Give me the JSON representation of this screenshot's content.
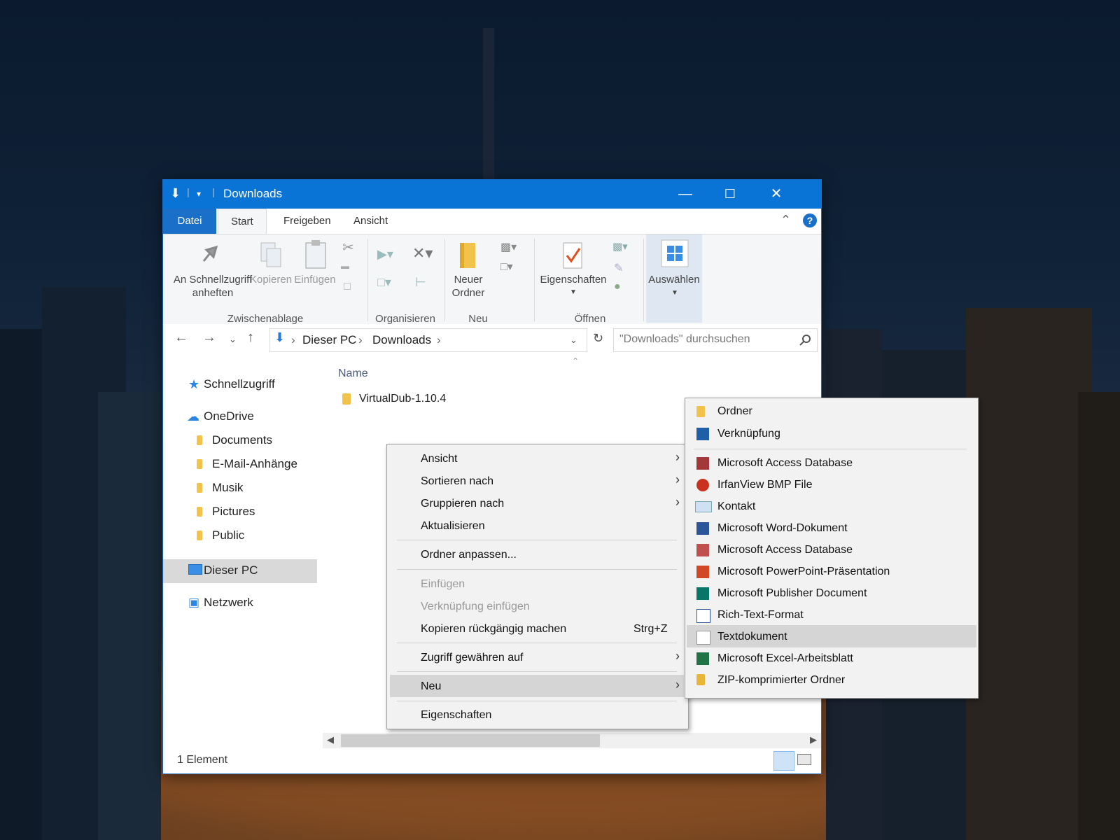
{
  "window": {
    "title": "Downloads",
    "controls": {
      "minimize": "—",
      "maximize": "☐",
      "close": "✕"
    }
  },
  "ribbon_tabs": [
    "Datei",
    "Start",
    "Freigeben",
    "Ansicht"
  ],
  "ribbon": {
    "pin_label_1": "An Schnellzugriff",
    "pin_label_2": "anheften",
    "copy": "Kopieren",
    "paste": "Einfügen",
    "group_clipboard": "Zwischenablage",
    "group_organize": "Organisieren",
    "new_folder_1": "Neuer",
    "new_folder_2": "Ordner",
    "group_new": "Neu",
    "properties": "Eigenschaften",
    "group_open": "Öffnen",
    "select": "Auswählen"
  },
  "address": {
    "crumbs": [
      "Dieser PC",
      "Downloads"
    ],
    "search_placeholder": "\"Downloads\" durchsuchen"
  },
  "sidebar": {
    "items": [
      "Schnellzugriff",
      "OneDrive",
      "Documents",
      "E-Mail-Anhänge",
      "Musik",
      "Pictures",
      "Public",
      "Dieser PC",
      "Netzwerk"
    ]
  },
  "content": {
    "column_name": "Name",
    "files": [
      "VirtualDub-1.10.4"
    ]
  },
  "status": {
    "count": "1 Element"
  },
  "context_menu": {
    "items": [
      "Ansicht",
      "Sortieren nach",
      "Gruppieren nach",
      "Aktualisieren",
      "Ordner anpassen...",
      "Einfügen",
      "Verknüpfung einfügen",
      "Kopieren rückgängig machen",
      "Zugriff gewähren auf",
      "Neu",
      "Eigenschaften"
    ],
    "undo_shortcut": "Strg+Z"
  },
  "submenu_new": {
    "items": [
      "Ordner",
      "Verknüpfung",
      "Microsoft Access Database",
      "IrfanView BMP File",
      "Kontakt",
      "Microsoft Word-Dokument",
      "Microsoft Access Database",
      "Microsoft PowerPoint-Präsentation",
      "Microsoft Publisher Document",
      "Rich-Text-Format",
      "Textdokument",
      "Microsoft Excel-Arbeitsblatt",
      "ZIP-komprimierter Ordner"
    ]
  },
  "colors": {
    "accent": "#0a74d6",
    "folder": "#f1c34b"
  }
}
